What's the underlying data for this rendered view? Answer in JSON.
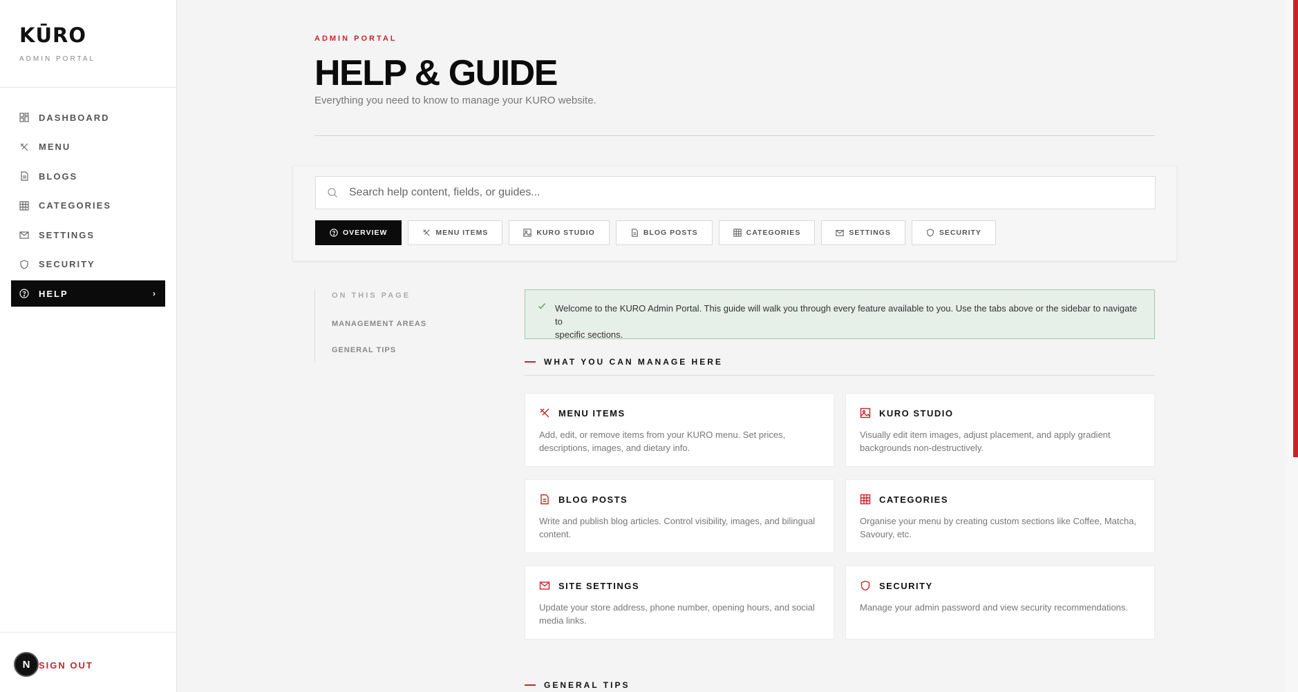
{
  "brand": {
    "logo": "KŪRO",
    "subtitle": "ADMIN PORTAL"
  },
  "sidebar": {
    "items": [
      {
        "label": "DASHBOARD",
        "icon": "dashboard-icon"
      },
      {
        "label": "MENU",
        "icon": "utensils-icon"
      },
      {
        "label": "BLOGS",
        "icon": "document-icon"
      },
      {
        "label": "CATEGORIES",
        "icon": "grid-icon"
      },
      {
        "label": "SETTINGS",
        "icon": "mail-icon"
      },
      {
        "label": "SECURITY",
        "icon": "shield-icon"
      },
      {
        "label": "HELP",
        "icon": "help-circle-icon",
        "active": true,
        "chevron": "›"
      }
    ],
    "signout": "SIGN OUT",
    "badge": "N"
  },
  "header": {
    "eyebrow": "ADMIN PORTAL",
    "title": "HELP & GUIDE",
    "subtitle": "Everything you need to know to manage your KURO website."
  },
  "search": {
    "placeholder": "Search help content, fields, or guides...",
    "value": ""
  },
  "tabs": [
    {
      "label": "OVERVIEW",
      "icon": "help-circle-icon",
      "active": true
    },
    {
      "label": "MENU ITEMS",
      "icon": "utensils-icon"
    },
    {
      "label": "KURO STUDIO",
      "icon": "image-icon"
    },
    {
      "label": "BLOG POSTS",
      "icon": "document-icon"
    },
    {
      "label": "CATEGORIES",
      "icon": "grid-icon"
    },
    {
      "label": "SETTINGS",
      "icon": "mail-icon"
    },
    {
      "label": "SECURITY",
      "icon": "shield-icon"
    }
  ],
  "toc": {
    "title": "ON THIS PAGE",
    "items": [
      "MANAGEMENT AREAS",
      "GENERAL TIPS"
    ]
  },
  "welcome": {
    "line1": "Welcome to the KURO Admin Portal. This guide will walk you through every feature available to you. Use the tabs above or the sidebar to navigate to",
    "line2": "specific sections."
  },
  "sections": {
    "manage_title": "WHAT YOU CAN MANAGE HERE",
    "tips_title": "GENERAL TIPS"
  },
  "cards": [
    {
      "title": "MENU ITEMS",
      "icon": "utensils-icon",
      "desc": "Add, edit, or remove items from your KURO menu. Set prices, descriptions, images, and dietary info."
    },
    {
      "title": "KURO STUDIO",
      "icon": "image-icon",
      "desc": "Visually edit item images, adjust placement, and apply gradient backgrounds non-destructively."
    },
    {
      "title": "BLOG POSTS",
      "icon": "document-icon",
      "desc": "Write and publish blog articles. Control visibility, images, and bilingual content."
    },
    {
      "title": "CATEGORIES",
      "icon": "grid-icon",
      "desc": "Organise your menu by creating custom sections like Coffee, Matcha, Savoury, etc."
    },
    {
      "title": "SITE SETTINGS",
      "icon": "mail-icon",
      "desc": "Update your store address, phone number, opening hours, and social media links."
    },
    {
      "title": "SECURITY",
      "icon": "shield-icon",
      "desc": "Manage your admin password and view security recommendations."
    }
  ],
  "colors": {
    "accent": "#c8232c",
    "dark": "#0b0b0b",
    "success_bg": "#e7efe9",
    "success_border": "#9fc9aa"
  }
}
